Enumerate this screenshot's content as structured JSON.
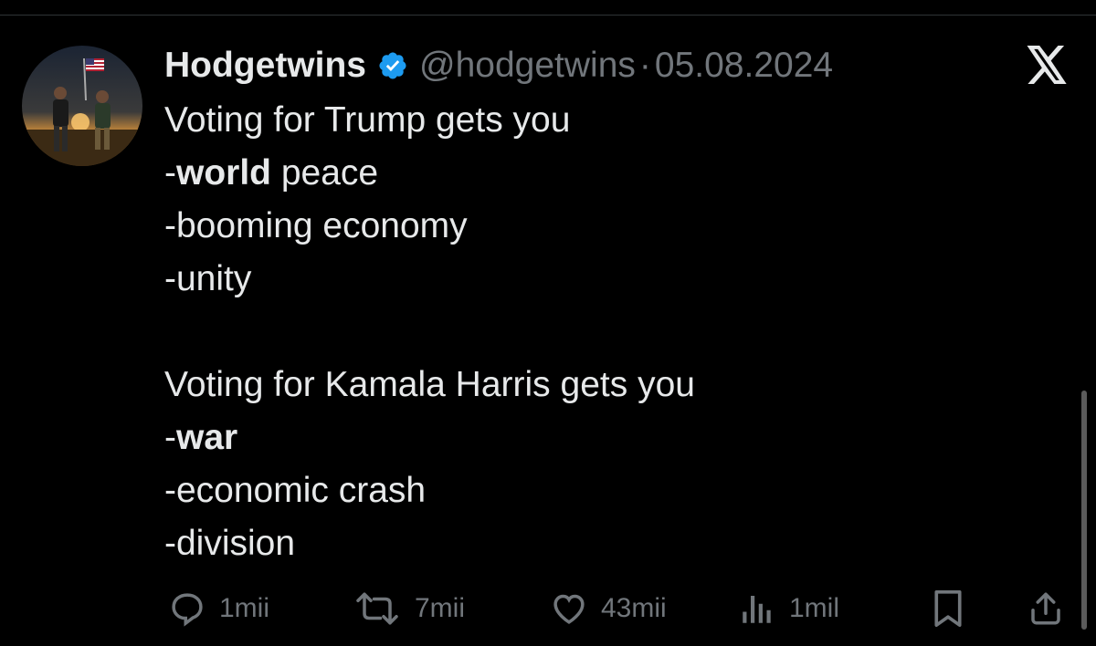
{
  "tweet": {
    "display_name": "Hodgetwins",
    "handle": "@hodgetwins",
    "separator": "·",
    "date": "05.08.2024",
    "lines": [
      {
        "prefix": "Voting for Trump gets you",
        "bold": "",
        "rest": ""
      },
      {
        "prefix": "-",
        "bold": "world",
        "rest": " peace"
      },
      {
        "prefix": "-booming economy",
        "bold": "",
        "rest": ""
      },
      {
        "prefix": "-unity",
        "bold": "",
        "rest": ""
      },
      {
        "prefix": "",
        "bold": "",
        "rest": ""
      },
      {
        "prefix": "Voting for Kamala Harris gets you",
        "bold": "",
        "rest": ""
      },
      {
        "prefix": "-",
        "bold": "war",
        "rest": ""
      },
      {
        "prefix": "-economic crash",
        "bold": "",
        "rest": ""
      },
      {
        "prefix": "-division",
        "bold": "",
        "rest": ""
      }
    ]
  },
  "actions": {
    "reply_count": "1mii",
    "retweet_count": "7mii",
    "like_count": "43mii",
    "views_count": "1mil"
  },
  "icons": {
    "verified": "verified-badge-icon",
    "brand": "x-logo-icon",
    "reply": "reply-icon",
    "retweet": "retweet-icon",
    "like": "heart-icon",
    "views": "views-icon",
    "bookmark": "bookmark-icon",
    "share": "share-icon"
  },
  "colors": {
    "background": "#000000",
    "text": "#e7e9ea",
    "muted": "#71767b",
    "verified": "#1d9bf0"
  }
}
